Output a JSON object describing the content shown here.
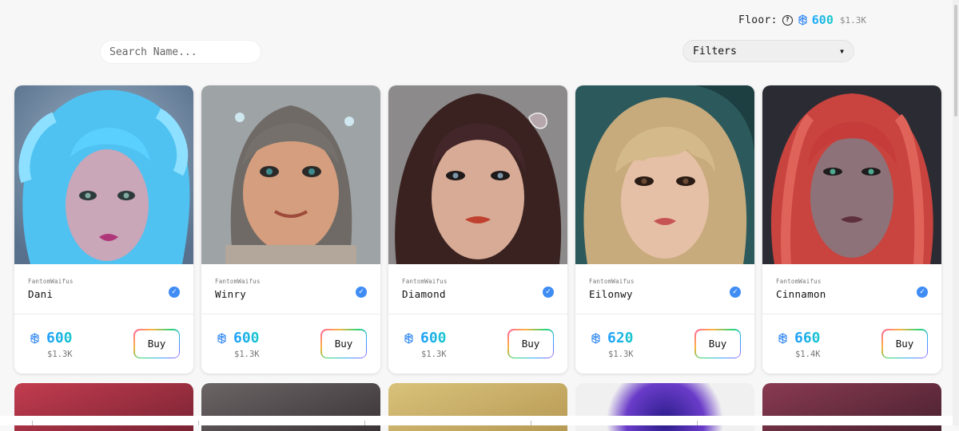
{
  "floor": {
    "label": "Floor:",
    "help_icon": "question-circle-icon",
    "currency_icon": "fantom-icon",
    "price": "600",
    "usd": "$1.3K"
  },
  "search": {
    "placeholder": "Search Name..."
  },
  "filters": {
    "label": "Filters",
    "icon": "caret-down-icon"
  },
  "cards": [
    {
      "collection": "FantomWaifus",
      "name": "Dani",
      "price": "600",
      "usd": "$1.3K",
      "buy_label": "Buy"
    },
    {
      "collection": "FantomWaifus",
      "name": "Winry",
      "price": "600",
      "usd": "$1.3K",
      "buy_label": "Buy"
    },
    {
      "collection": "FantomWaifus",
      "name": "Diamond",
      "price": "600",
      "usd": "$1.3K",
      "buy_label": "Buy"
    },
    {
      "collection": "FantomWaifus",
      "name": "Eilonwy",
      "price": "620",
      "usd": "$1.3K",
      "buy_label": "Buy"
    },
    {
      "collection": "FantomWaifus",
      "name": "Cinnamon",
      "price": "660",
      "usd": "$1.4K",
      "buy_label": "Buy"
    }
  ],
  "colors": {
    "accent_gradient": [
      "#1e9cff",
      "#18c9c9"
    ],
    "verified": "#3f8cf5"
  }
}
